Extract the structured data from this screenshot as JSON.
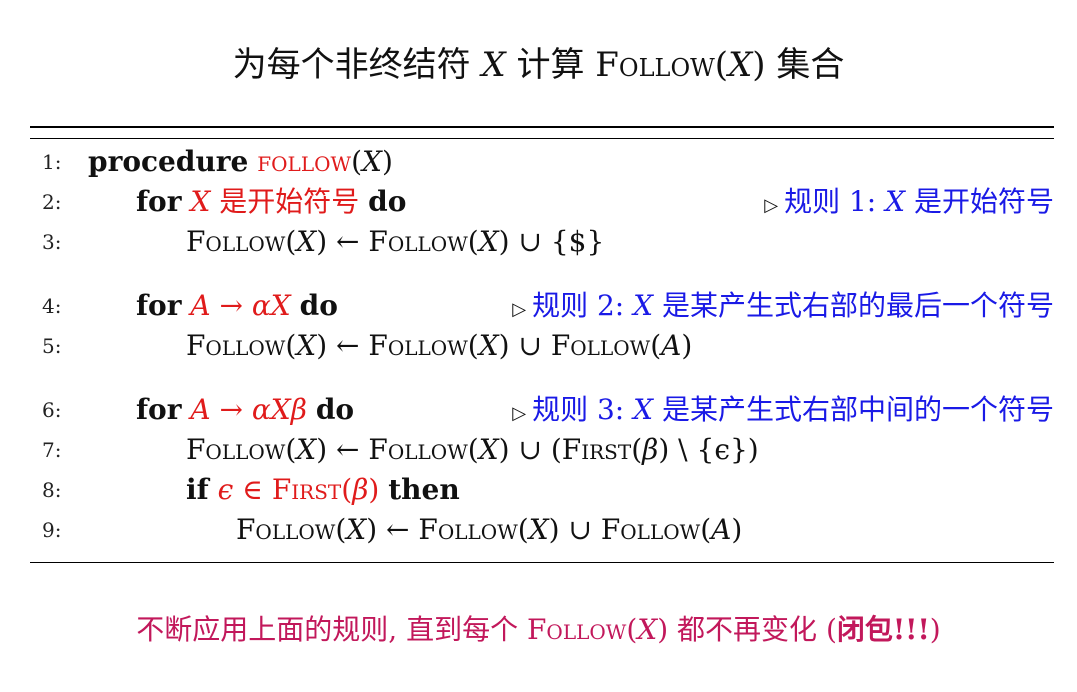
{
  "title": {
    "prefix": "为每个非终结符 ",
    "var": "X",
    "middle": " 计算 ",
    "func": "Follow",
    "arg_open": "(",
    "arg": "X",
    "arg_close": ")",
    "suffix": " 集合"
  },
  "algorithm": [
    {
      "num": "1:",
      "kw": "procedure",
      "name": "follow",
      "arg_open": "(",
      "arg": "X",
      "arg_close": ")"
    },
    {
      "num": "2:",
      "kw": "for",
      "cond_var": "X",
      "cond_text": " 是开始符号 ",
      "kw2": "do",
      "comment_tri": "▷",
      "comment_a": "规则 1: ",
      "comment_var": "X",
      "comment_b": " 是开始符号"
    },
    {
      "num": "3:",
      "stmt": {
        "lhs": "Follow",
        "lhs_arg": "X",
        "arrow": " ← ",
        "rhs": "Follow",
        "rhs_arg": "X",
        "tail": " ∪ {$}"
      }
    },
    {
      "num": "4:",
      "kw": "for",
      "cond": "A → αX",
      "kw2": "do",
      "comment_tri": "▷",
      "comment_a": "规则 2: ",
      "comment_var": "X",
      "comment_b": " 是某产生式右部的最后一个符号"
    },
    {
      "num": "5:",
      "stmt": {
        "lhs": "Follow",
        "lhs_arg": "X",
        "arrow": " ← ",
        "rhs": "Follow",
        "rhs_arg": "X",
        "union": " ∪ ",
        "rhs2": "Follow",
        "rhs2_arg": "A"
      }
    },
    {
      "num": "6:",
      "kw": "for",
      "cond": "A → αXβ",
      "kw2": "do",
      "comment_tri": "▷",
      "comment_a": "规则 3: ",
      "comment_var": "X",
      "comment_b": " 是某产生式右部中间的一个符号"
    },
    {
      "num": "7:",
      "stmt": {
        "lhs": "Follow",
        "lhs_arg": "X",
        "arrow": " ← ",
        "rhs": "Follow",
        "rhs_arg": "X",
        "union": " ∪ (",
        "rhs2": "First",
        "rhs2_arg": "β",
        "tail": " \\ {ϵ})"
      }
    },
    {
      "num": "8:",
      "kw": "if",
      "cond_a": "ϵ ∈ ",
      "cond_func": "First",
      "cond_arg": "β",
      "kw2": "then"
    },
    {
      "num": "9:",
      "stmt": {
        "lhs": "Follow",
        "lhs_arg": "X",
        "arrow": " ← ",
        "rhs": "Follow",
        "rhs_arg": "X",
        "union": " ∪ ",
        "rhs2": "Follow",
        "rhs2_arg": "A"
      }
    }
  ],
  "footer": {
    "text_a": "不断应用上面的规则, 直到每个 ",
    "func": "Follow",
    "arg": "X",
    "text_b": " 都不再变化 (",
    "bold": "闭包!!!",
    "text_c": ")"
  },
  "colors": {
    "keyword_red": "#e01b1b",
    "comment_blue": "#1a1ae6",
    "footer": "#c2185b"
  }
}
